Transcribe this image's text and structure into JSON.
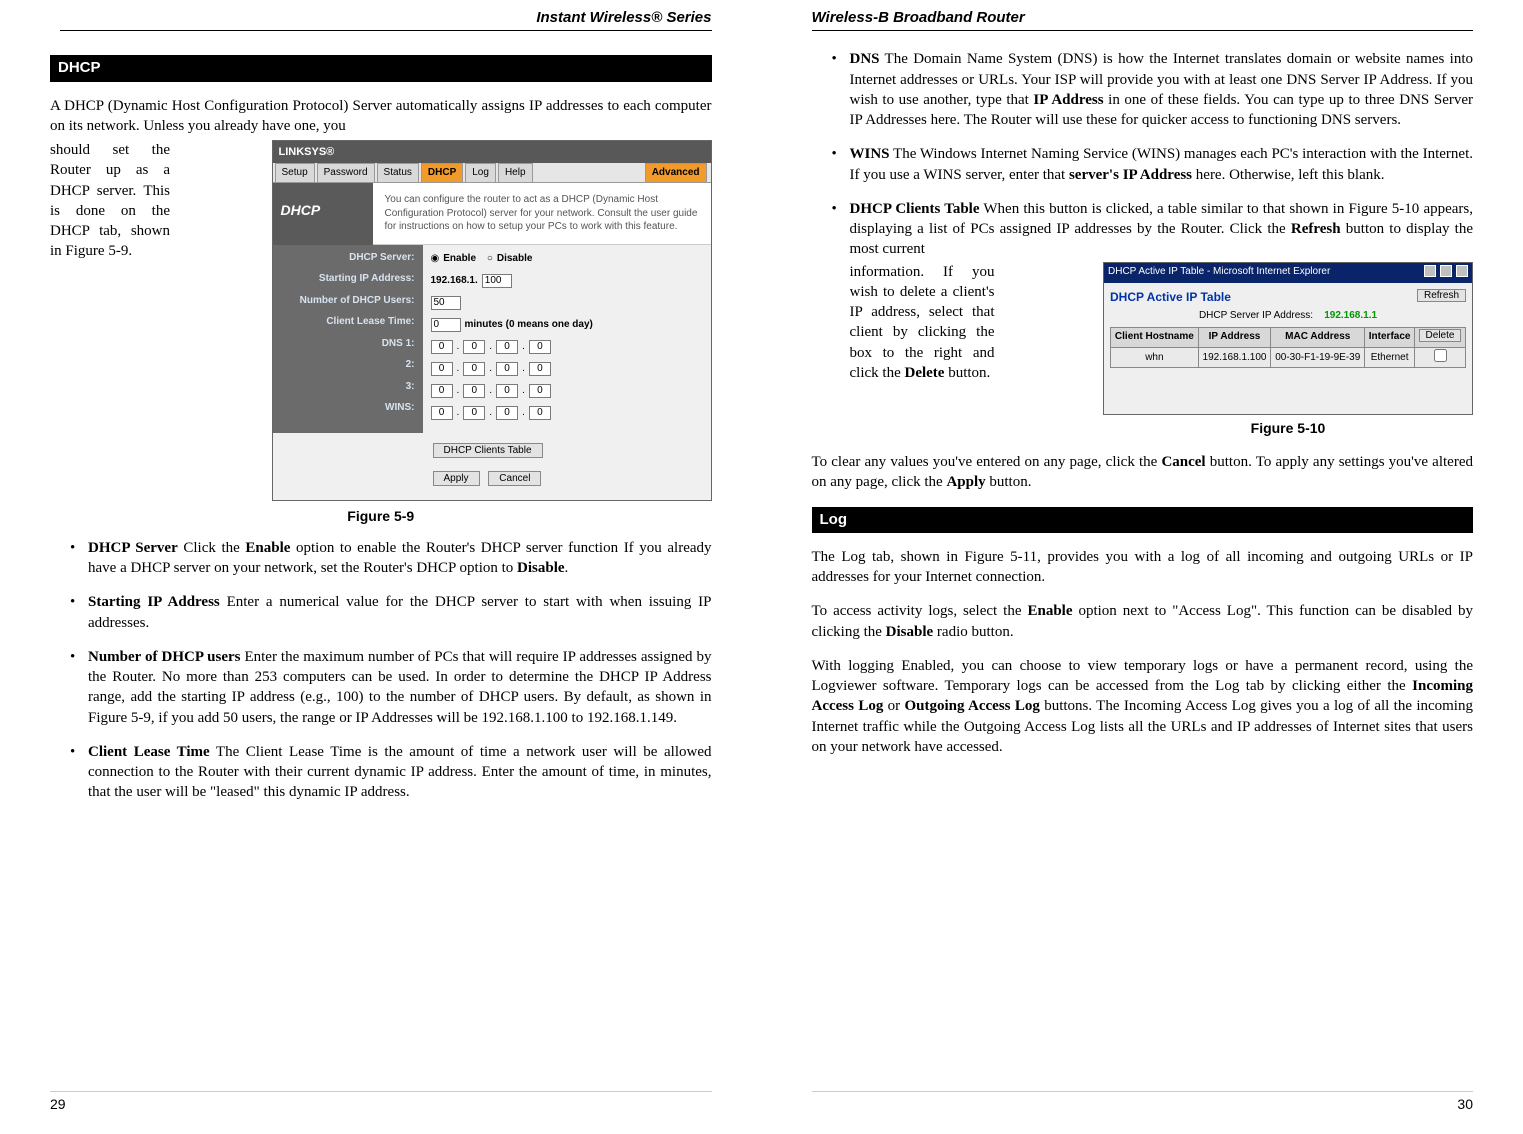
{
  "left": {
    "header": "Instant Wireless® Series",
    "section": "DHCP",
    "intro": "A DHCP (Dynamic Host Configuration Protocol) Server automatically assigns IP addresses to each computer on its network. Unless you already have one, you",
    "wrap_text": "should set the Router up as a DHCP server. This is done on the DHCP tab, shown in Figure 5-9.",
    "figure59": {
      "brand": "LINKSYS®",
      "tabs": [
        "Setup",
        "Password",
        "Status",
        "DHCP",
        "Log",
        "Help"
      ],
      "advanced": "Advanced",
      "side": "DHCP",
      "desc": "You can configure the router to act as a DHCP (Dynamic Host Configuration Protocol) server for your network. Consult the user guide for instructions on how to setup your PCs to work with this feature.",
      "labels": {
        "server": "DHCP Server:",
        "start": "Starting IP Address:",
        "num": "Number of DHCP Users:",
        "lease": "Client Lease Time:",
        "dns1": "DNS 1:",
        "dns2": "2:",
        "dns3": "3:",
        "wins": "WINS:"
      },
      "values": {
        "enable": "Enable",
        "disable": "Disable",
        "start_prefix": "192.168.1.",
        "start_last": "100",
        "num": "50",
        "lease": "0",
        "lease_hint": "minutes (0 means one day)",
        "oct": "0"
      },
      "buttons": {
        "clients": "DHCP Clients Table",
        "apply": "Apply",
        "cancel": "Cancel"
      }
    },
    "caption59": "Figure 5-9",
    "bullets": [
      "<b>DHCP Server</b>  Click the <b>Enable</b> option to enable the Router's DHCP server function  If you already have a DHCP server on your network, set the Router's DHCP option to <b>Disable</b>.",
      "<b>Starting IP Address</b>  Enter a numerical value for the DHCP server to start with when issuing IP addresses.",
      "<b>Number of DHCP users</b>   Enter the maximum number of PCs that will require IP addresses assigned by the Router. No more than 253 computers can be used.  In order to determine the DHCP IP Address range, add the starting IP address (e.g., 100) to the number of DHCP users.  By default, as shown in Figure 5-9, if you add 50 users, the range or IP Addresses will be 192.168.1.100 to 192.168.1.149.",
      "<b>Client Lease Time</b>  The Client Lease Time is the amount of time a network user will be allowed connection to the Router with their current dynamic IP address. Enter the amount of time, in minutes, that the user will be \"leased\" this dynamic IP address."
    ],
    "page_num": "29"
  },
  "right": {
    "header": "Wireless-B Broadband Router",
    "bullets_top": [
      "<b>DNS</b>   The Domain Name System (DNS) is how the Internet translates domain or website names into Internet addresses or URLs. Your ISP will provide you with at least one DNS Server IP Address. If you wish to use another, type that <b>IP Address</b> in one of these fields. You can type up to three DNS Server IP Addresses here. The Router will use these for quicker access to functioning DNS servers.",
      "<b>WINS</b>  The Windows Internet Naming Service (WINS) manages each PC's interaction with the Internet. If you use a WINS server, enter that <b>server's IP Address</b> here. Otherwise, left this blank."
    ],
    "dhcp_clients_lead": "<b>DHCP Clients Table</b>   When this button is clicked, a table similar to that shown in Figure 5-10 appears, displaying a list of PCs assigned IP addresses by the Router. Click the <b>Refresh</b> button to display the most current",
    "dhcp_clients_wrap": "information. If you wish to delete a client's IP address, select that client by clicking the box to the right and click the <b>Delete</b> button.",
    "fig510": {
      "window_title": "DHCP Active IP Table - Microsoft Internet Explorer",
      "title": "DHCP Active IP Table",
      "refresh": "Refresh",
      "server_label": "DHCP Server IP Address:",
      "server_ip": "192.168.1.1",
      "cols": [
        "Client Hostname",
        "IP Address",
        "MAC Address",
        "Interface"
      ],
      "delete": "Delete",
      "row": {
        "host": "whn",
        "ip": "192.168.1.100",
        "mac": "00-30-F1-19-9E-39",
        "iface": "Ethernet"
      }
    },
    "caption510": "Figure 5-10",
    "clear_para": "To clear any values you've entered on any page, click  the <b>Cancel</b> button.  To apply any settings you've altered on any page, click the <b>Apply</b> button.",
    "section": "Log",
    "log_p1": "The Log tab, shown in Figure 5-11, provides you with a log of all incoming and outgoing URLs or IP addresses for your Internet connection.",
    "log_p2": "To access activity logs, select the <b>Enable</b> option next to \"Access Log\". This function can be disabled by clicking the <b>Disable</b> radio button.",
    "log_p3": "With logging Enabled, you can choose to view temporary logs or have a permanent record, using the Logviewer software.  Temporary logs can be accessed from the Log tab by clicking either the <b>Incoming Access Log</b> or <b>Outgoing Access Log</b> buttons.   The Incoming Access Log gives you a log of all the incoming Internet traffic while the Outgoing Access Log lists all the URLs and IP addresses of Internet sites that users on your network have accessed.",
    "page_num": "30"
  }
}
